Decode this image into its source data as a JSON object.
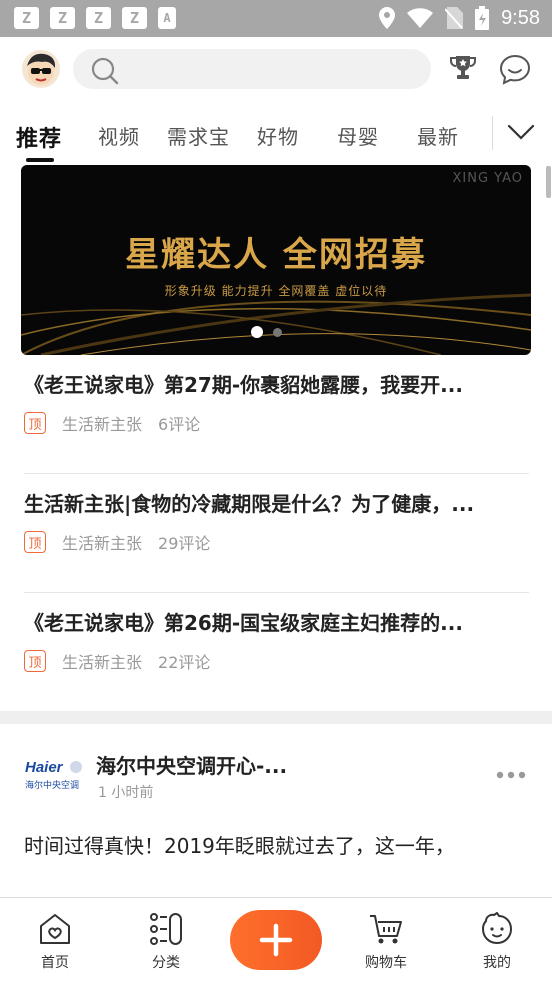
{
  "status_bar": {
    "left_icons": [
      "Z",
      "Z",
      "Z",
      "Z",
      "A"
    ],
    "time": "9:58",
    "right_icons": [
      "location-icon",
      "wifi-icon",
      "no-sim-icon",
      "battery-icon"
    ]
  },
  "header": {
    "search_placeholder": "",
    "icons": [
      "search-icon",
      "trophy-icon",
      "message-icon"
    ]
  },
  "tabs": [
    {
      "label": "推荐",
      "active": true
    },
    {
      "label": "视频"
    },
    {
      "label": "需求宝"
    },
    {
      "label": "好物"
    },
    {
      "label": "母婴"
    },
    {
      "label": "最新"
    }
  ],
  "banner": {
    "brand": "XING YAO",
    "title": "星耀达人 全网招募",
    "subtitle": "形象升级  能力提升  全网覆盖  虚位以待",
    "slides": 2,
    "active_slide": 1
  },
  "articles": [
    {
      "title": "《老王说家电》第27期-你裹貂她露腰，我要开...",
      "badge": "顶",
      "author": "生活新主张",
      "comments": "6评论"
    },
    {
      "title": "生活新主张|食物的冷藏期限是什么？为了健康，...",
      "badge": "顶",
      "author": "生活新主张",
      "comments": "29评论"
    },
    {
      "title": "《老王说家电》第26期-国宝级家庭主妇推荐的...",
      "badge": "顶",
      "author": "生活新主张",
      "comments": "22评论"
    }
  ],
  "post": {
    "logo_text": "Haier 海尔中央空调",
    "name": "海尔中央空调开心-...",
    "time": "1 小时前",
    "text": "时间过得真快！2019年眨眼就过去了，这一年，"
  },
  "bottom_nav": [
    {
      "label": "首页"
    },
    {
      "label": "分类"
    },
    {
      "label": ""
    },
    {
      "label": "购物车"
    },
    {
      "label": "我的"
    }
  ],
  "colors": {
    "accent": "#f25a24",
    "status_bar": "#a7a7a7",
    "banner_gold": "#d9a64a"
  }
}
